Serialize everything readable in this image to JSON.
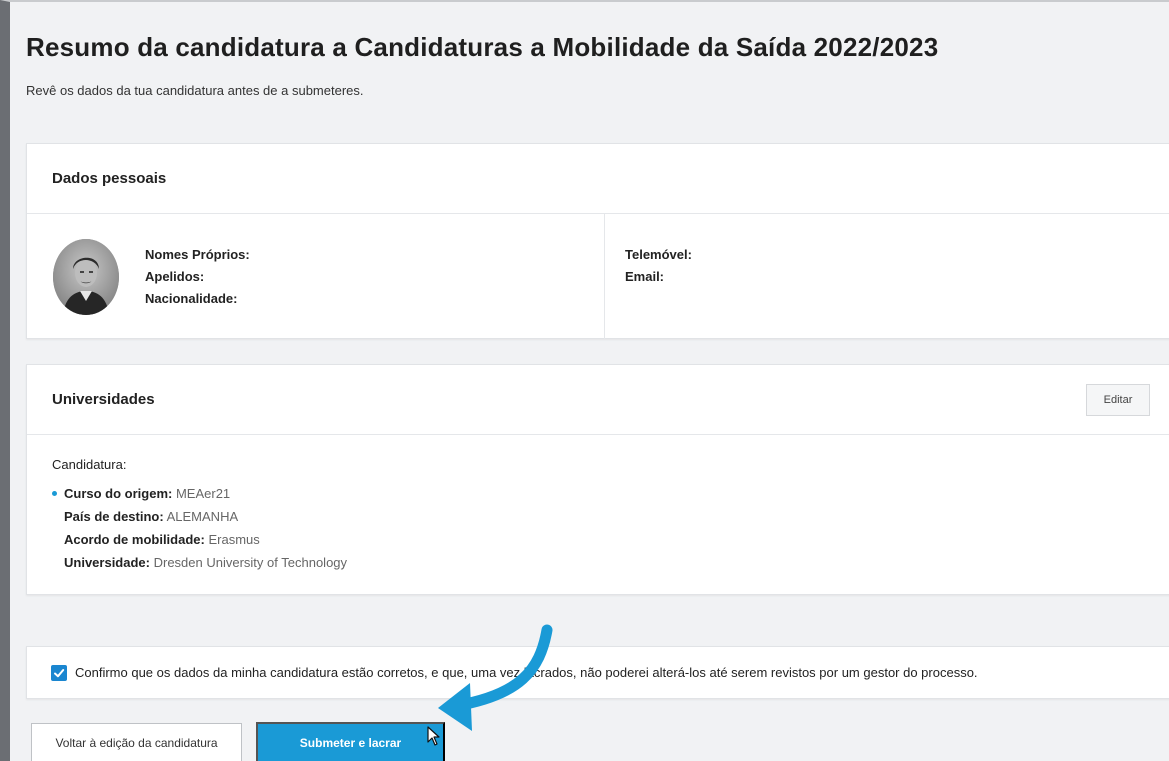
{
  "page": {
    "title": "Resumo da candidatura a Candidaturas a Mobilidade da Saída 2022/2023",
    "subtitle": "Revê os dados da tua candidatura antes de a submeteres."
  },
  "personal": {
    "title": "Dados pessoais",
    "given_names_label": "Nomes Próprios:",
    "given_names_value": "",
    "surnames_label": "Apelidos:",
    "surnames_value": "",
    "nationality_label": "Nacionalidade:",
    "nationality_value": "",
    "phone_label": "Telemóvel:",
    "phone_value": "",
    "email_label": "Email:",
    "email_value": ""
  },
  "universities": {
    "title": "Universidades",
    "edit_label": "Editar",
    "application_label": "Candidatura:",
    "items": [
      {
        "label": "Curso do origem:",
        "value": "MEAer21"
      },
      {
        "label": "País de destino:",
        "value": "ALEMANHA"
      },
      {
        "label": "Acordo de mobilidade:",
        "value": "Erasmus"
      },
      {
        "label": "Universidade:",
        "value": "Dresden University of Technology"
      }
    ]
  },
  "confirm": {
    "checked": true,
    "text": "Confirmo que os dados da minha candidatura estão corretos, e que, uma vez lacrados, não poderei alterá-los até serem revistos por um gestor do processo."
  },
  "actions": {
    "back_label": "Voltar à edição da candidatura",
    "submit_label": "Submeter e lacrar"
  },
  "colors": {
    "accent": "#1a9ad6",
    "annotation_arrow": "#1a9ad6"
  }
}
